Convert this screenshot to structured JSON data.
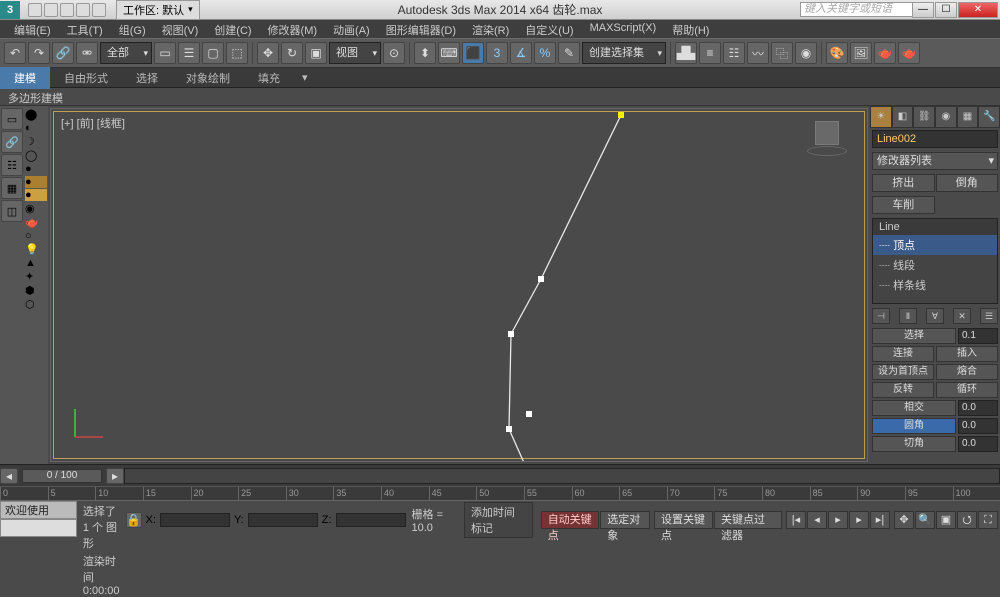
{
  "titlebar": {
    "workspace_label": "工作区: 默认",
    "app_title": "Autodesk 3ds Max  2014 x64   齿轮.max",
    "search_placeholder": "键入关键字或短语"
  },
  "menus": [
    "编辑(E)",
    "工具(T)",
    "组(G)",
    "视图(V)",
    "创建(C)",
    "修改器(M)",
    "动画(A)",
    "图形编辑器(D)",
    "渲染(R)",
    "自定义(U)",
    "MAXScript(X)",
    "帮助(H)"
  ],
  "toolbar": {
    "all_label": "全部",
    "view_label": "视图",
    "selset_label": "创建选择集"
  },
  "ribbon": {
    "tabs": [
      "建模",
      "自由形式",
      "选择",
      "对象绘制",
      "填充"
    ]
  },
  "subbar": {
    "label": "多边形建模"
  },
  "viewport": {
    "label": "[+] [前] [线框]"
  },
  "cmdpanel": {
    "object_name": "Line002",
    "modifier_list": "修改器列表",
    "btn_extrude": "挤出",
    "btn_bevel": "倒角",
    "btn_lathe": "车削",
    "stack_header": "Line",
    "stack_items": [
      "顶点",
      "线段",
      "样条线"
    ],
    "r_connect": "连接",
    "r_insert": "插入",
    "r_makefirst": "设为首顶点",
    "r_weld": "熔合",
    "r_reverse": "反转",
    "r_cycle": "循环",
    "r_intersect": "相交",
    "r_fillet": "圆角",
    "r_chamfer": "切角",
    "r_spin0": "0.0",
    "r_spin1": "0.0",
    "r_spin2": "0.0",
    "r_sel": "选择",
    "r_val": "0.1"
  },
  "timeline": {
    "slider": "0 / 100",
    "ticks": [
      "0",
      "5",
      "10",
      "15",
      "20",
      "25",
      "30",
      "35",
      "40",
      "45",
      "50",
      "55",
      "60",
      "65",
      "70",
      "75",
      "80",
      "85",
      "90",
      "95",
      "100"
    ]
  },
  "status": {
    "welcome": "欢迎使用  MAXScr",
    "sel_info": "选择了 1 个 图形",
    "rendertime": "渲染时间 0:00:00",
    "grid": "栅格 = 10.0",
    "autokey": "自动关键点",
    "setkey": "设置关键点",
    "selected": "选定对象",
    "keyfilter": "关键点过滤器",
    "addtime": "添加时间标记"
  }
}
